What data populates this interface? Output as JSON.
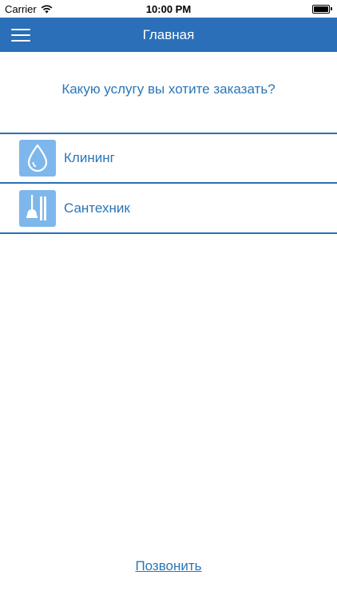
{
  "status_bar": {
    "carrier": "Carrier",
    "time": "10:00 PM",
    "icons": [
      "wifi-icon",
      "battery-icon"
    ]
  },
  "nav": {
    "title": "Главная",
    "menu_icon": "hamburger-menu-icon",
    "background_color": "#2a6fb8"
  },
  "main": {
    "question": "Какую услугу вы хотите заказать?",
    "services": [
      {
        "label": "Клининг",
        "icon": "water-drop-icon"
      },
      {
        "label": "Сантехник",
        "icon": "plunger-tools-icon"
      }
    ]
  },
  "footer": {
    "call_link": "Позвонить"
  },
  "colors": {
    "accent": "#2a6fb8",
    "text_blue": "#2a76b9",
    "icon_background": "#7db7ec"
  }
}
